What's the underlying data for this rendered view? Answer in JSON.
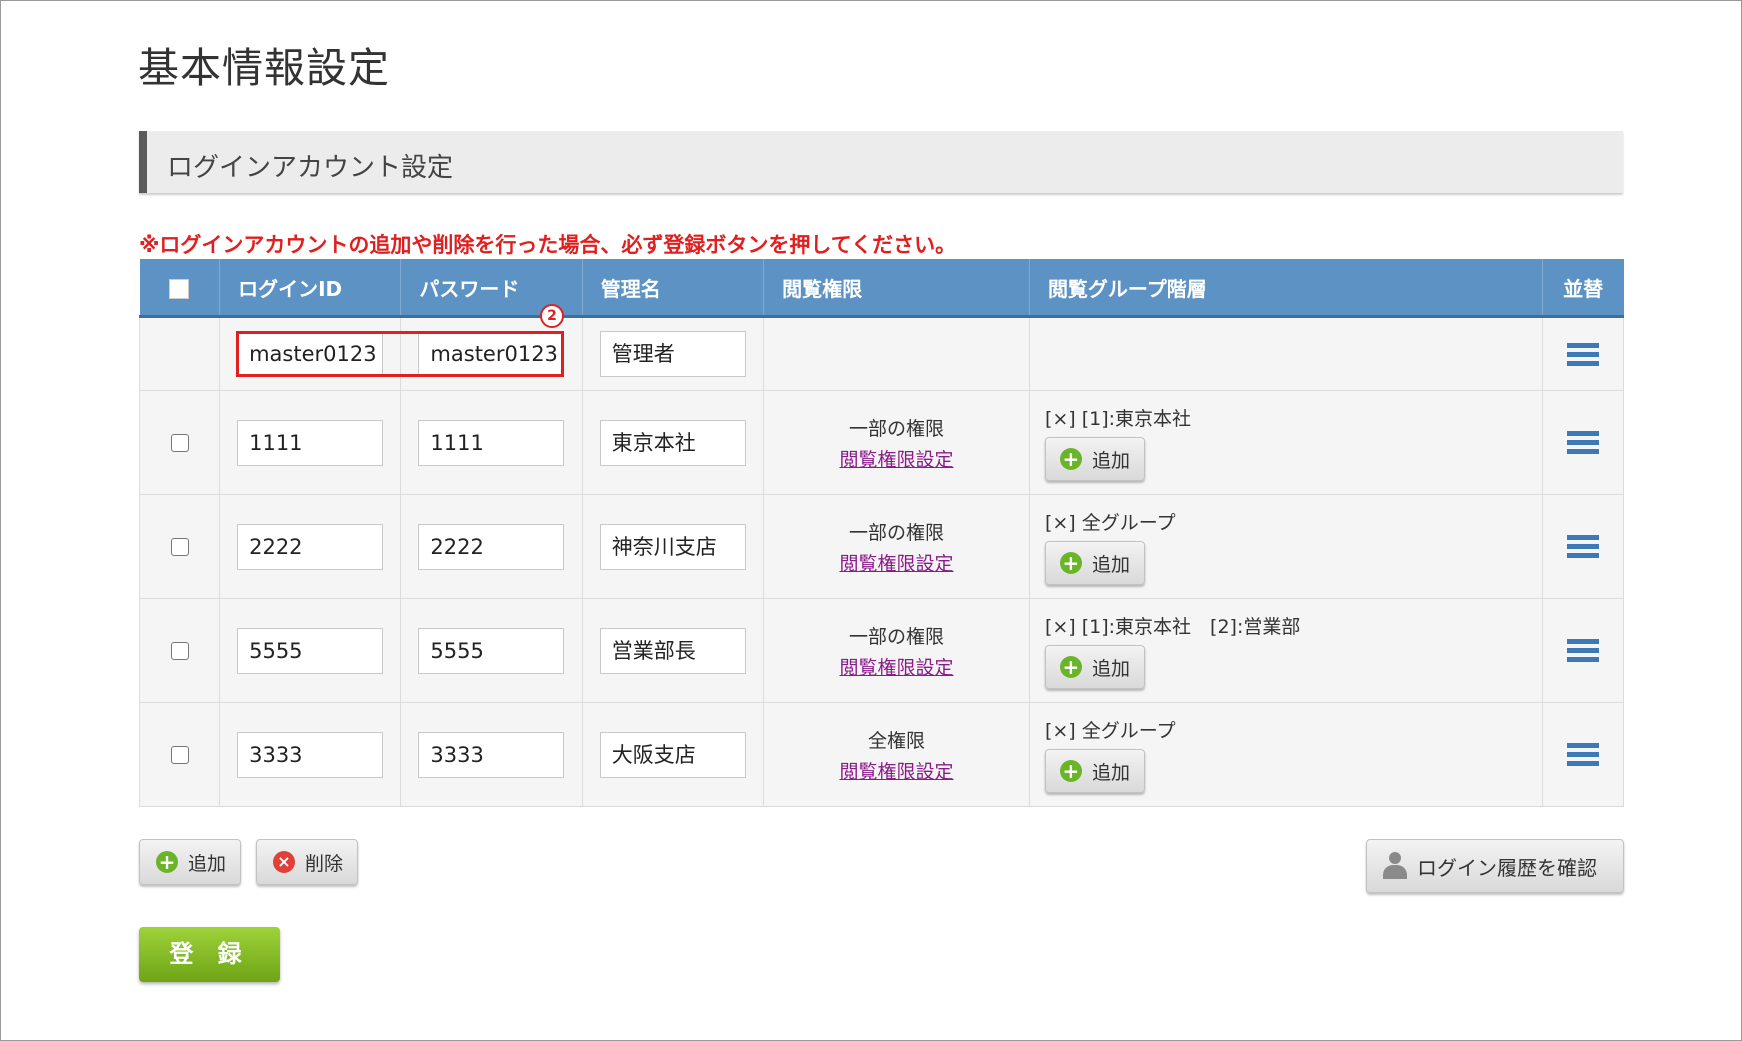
{
  "page": {
    "title": "基本情報設定"
  },
  "section": {
    "title": "ログインアカウント設定"
  },
  "warning": "※ログインアカウントの追加や削除を行った場合、必ず登録ボタンを押してください。",
  "table": {
    "headers": {
      "login_id": "ログインID",
      "password": "パスワード",
      "admin_name": "管理名",
      "view_permission": "閲覧権限",
      "view_group": "閲覧グループ階層",
      "sort": "並替"
    },
    "new_row": {
      "login_id": "master0123",
      "password": "master0123",
      "admin_name": "管理者"
    },
    "rows": [
      {
        "login_id": "1111",
        "password": "1111",
        "admin_name": "東京本社",
        "permission": "一部の権限",
        "permission_link": "閲覧権限設定",
        "groups": "[×] [1]:東京本社",
        "add_label": "追加"
      },
      {
        "login_id": "2222",
        "password": "2222",
        "admin_name": "神奈川支店",
        "permission": "一部の権限",
        "permission_link": "閲覧権限設定",
        "groups": "[×] 全グループ",
        "add_label": "追加"
      },
      {
        "login_id": "5555",
        "password": "5555",
        "admin_name": "営業部長",
        "permission": "一部の権限",
        "permission_link": "閲覧権限設定",
        "groups": "[×] [1]:東京本社　[2]:営業部",
        "add_label": "追加"
      },
      {
        "login_id": "3333",
        "password": "3333",
        "admin_name": "大阪支店",
        "permission": "全権限",
        "permission_link": "閲覧権限設定",
        "groups": "[×] 全グループ",
        "add_label": "追加"
      }
    ]
  },
  "annotation": {
    "badge": "2"
  },
  "buttons": {
    "add": "追加",
    "delete": "削除",
    "history": "ログイン履歴を確認",
    "submit": "登 録"
  },
  "colors": {
    "header_bg": "#5d93c4",
    "warning": "#e02020",
    "submit": "#7fbf24",
    "link": "#8b1a8b"
  }
}
